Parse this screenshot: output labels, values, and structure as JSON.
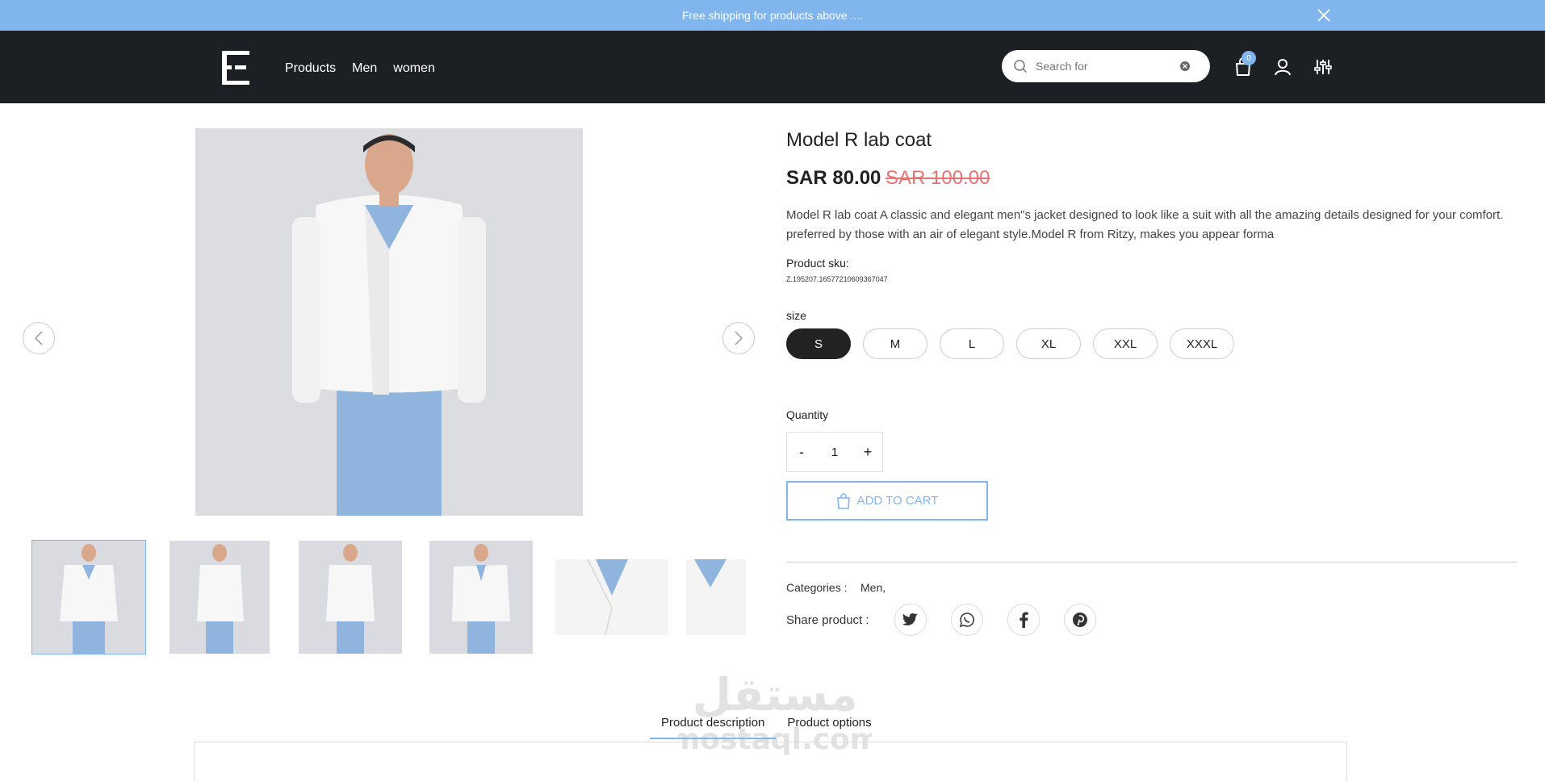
{
  "announcement": {
    "text": "Free shipping for products above ...."
  },
  "header": {
    "nav": [
      "Products",
      "Men",
      "women"
    ],
    "search": {
      "placeholder": "Search for",
      "value": ""
    },
    "cart_count": "0"
  },
  "product": {
    "title": "Model R lab coat",
    "price": "SAR 80.00",
    "old_price": "SAR 100.00",
    "description": " Model R lab coat A classic and elegant men\"s jacket designed to look like a suit with all the amazing details designed for your comfort. preferred by those with an air of elegant style.Model R from Ritzy, makes you appear forma",
    "sku_label": "Product sku:",
    "sku_value": "Z.195207.16577210609367047",
    "size_label": "size",
    "sizes": [
      "S",
      "M",
      "L",
      "XL",
      "XXL",
      "XXXL"
    ],
    "selected_size": "S",
    "quantity_label": "Quantity",
    "quantity": "1",
    "qty_minus": "-",
    "qty_plus": "+",
    "add_to_cart": "ADD TO CART",
    "categories_label": "Categories :",
    "categories_value": "Men,",
    "share_label": "Share product :"
  },
  "tabs": [
    "Product description",
    "Product options"
  ],
  "colors": {
    "accent": "#81b5ee",
    "header_bg": "#1c1f24",
    "old_price": "#e57373"
  },
  "icons": [
    "close-icon",
    "logo-icon",
    "search-icon",
    "clear-icon",
    "bag-icon",
    "user-icon",
    "filter-icon",
    "chevron-left-icon",
    "chevron-right-icon",
    "twitter-icon",
    "whatsapp-icon",
    "facebook-icon",
    "pinterest-icon"
  ],
  "watermark": {
    "text_ar": "مستقل",
    "text_en": "mostaql.com"
  }
}
